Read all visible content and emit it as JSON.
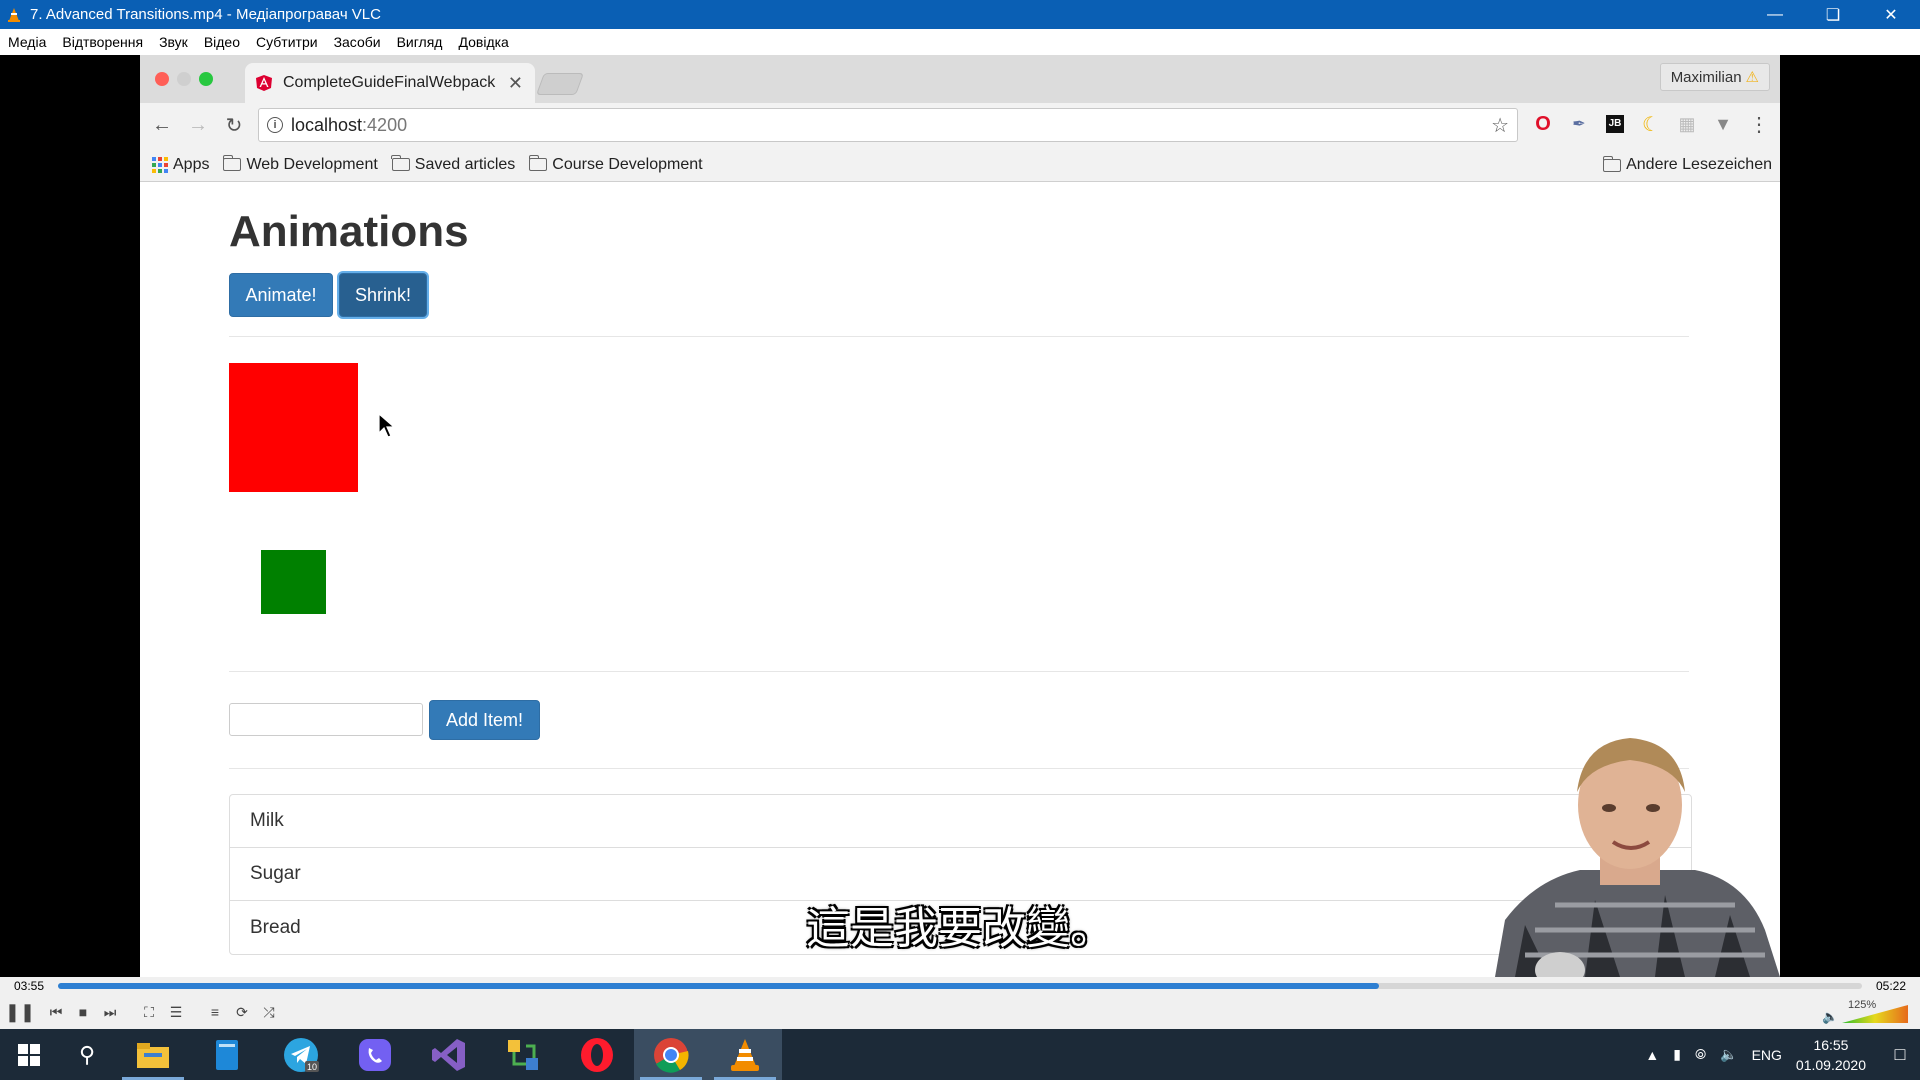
{
  "vlc": {
    "title": "7. Advanced Transitions.mp4 - Медіапрогравач VLC",
    "menu": [
      "Медіа",
      "Відтворення",
      "Звук",
      "Відео",
      "Субтитри",
      "Засоби",
      "Вигляд",
      "Довідка"
    ],
    "time_elapsed": "03:55",
    "time_total": "05:22",
    "progress": 0.732,
    "volume_label": "125%",
    "subtitle": "這是我要改變。"
  },
  "browser": {
    "tab_title": "CompleteGuideFinalWebpack",
    "profile_name": "Maximilian",
    "url_host": "localhost",
    "url_port": ":4200",
    "bookmarks": [
      "Apps",
      "Web Development",
      "Saved articles",
      "Course Development"
    ],
    "other_bookmarks": "Andere Lesezeichen"
  },
  "page": {
    "heading": "Animations",
    "animate_button": "Animate!",
    "shrink_button": "Shrink!",
    "add_item_button": "Add Item!",
    "input_value": "",
    "items": [
      "Milk",
      "Sugar",
      "Bread"
    ]
  },
  "taskbar": {
    "language": "ENG",
    "time": "16:55",
    "date": "01.09.2020",
    "telegram_badge": "10"
  },
  "colors": {
    "red_box": "#ff0000",
    "green_box": "#008000",
    "bootstrap_primary": "#337ab7",
    "vlc_titlebar": "#0a5fb4"
  }
}
